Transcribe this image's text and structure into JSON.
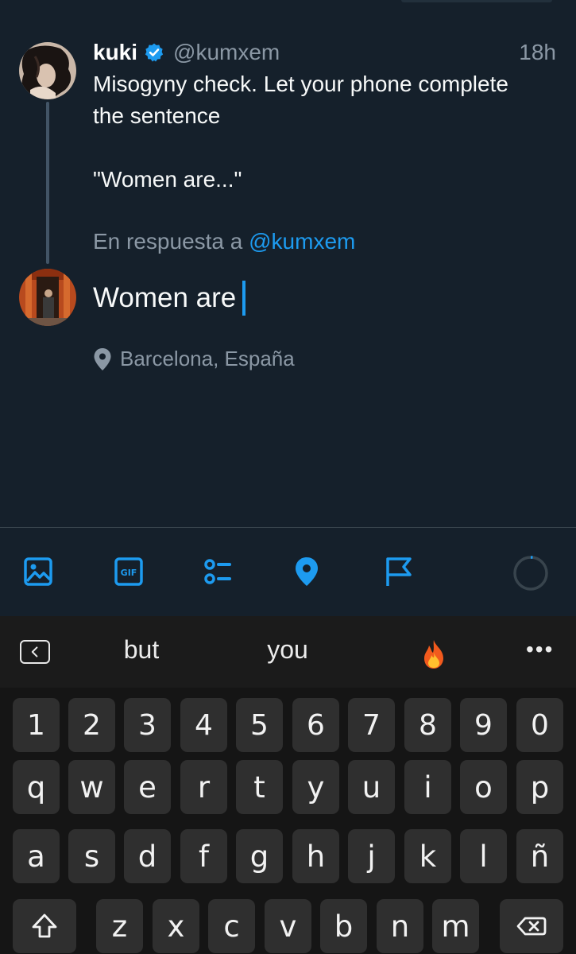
{
  "tweet": {
    "author_name": "kuki",
    "author_handle": "@kumxem",
    "time": "18h",
    "text": "Misogyny check. Let your phone complete\nthe sentence\n\n\"Women are...\"",
    "verified_icon": "verified-badge-icon"
  },
  "reply": {
    "prefix": "En respuesta a",
    "mention": "@kumxem",
    "draft_text": "Women are",
    "location": "Barcelona, España"
  },
  "toolbar": {
    "icons": [
      "image-icon",
      "gif-icon",
      "poll-icon",
      "location-icon",
      "flag-icon",
      "character-count-ring"
    ]
  },
  "keyboard": {
    "suggestions": [
      "but",
      "you",
      "🔥"
    ],
    "more": "•••",
    "number_row": [
      "1",
      "2",
      "3",
      "4",
      "5",
      "6",
      "7",
      "8",
      "9",
      "0"
    ],
    "row1": [
      "q",
      "w",
      "e",
      "r",
      "t",
      "y",
      "u",
      "i",
      "o",
      "p"
    ],
    "row2": [
      "a",
      "s",
      "d",
      "f",
      "g",
      "h",
      "j",
      "k",
      "l",
      "ñ"
    ],
    "row3": [
      "z",
      "x",
      "c",
      "v",
      "b",
      "n",
      "m"
    ]
  },
  "colors": {
    "background": "#15202b",
    "accent": "#1d9bf0",
    "secondary_text": "#8b98a5",
    "keyboard_bg": "#151515",
    "key_bg": "#2f2f2f"
  }
}
